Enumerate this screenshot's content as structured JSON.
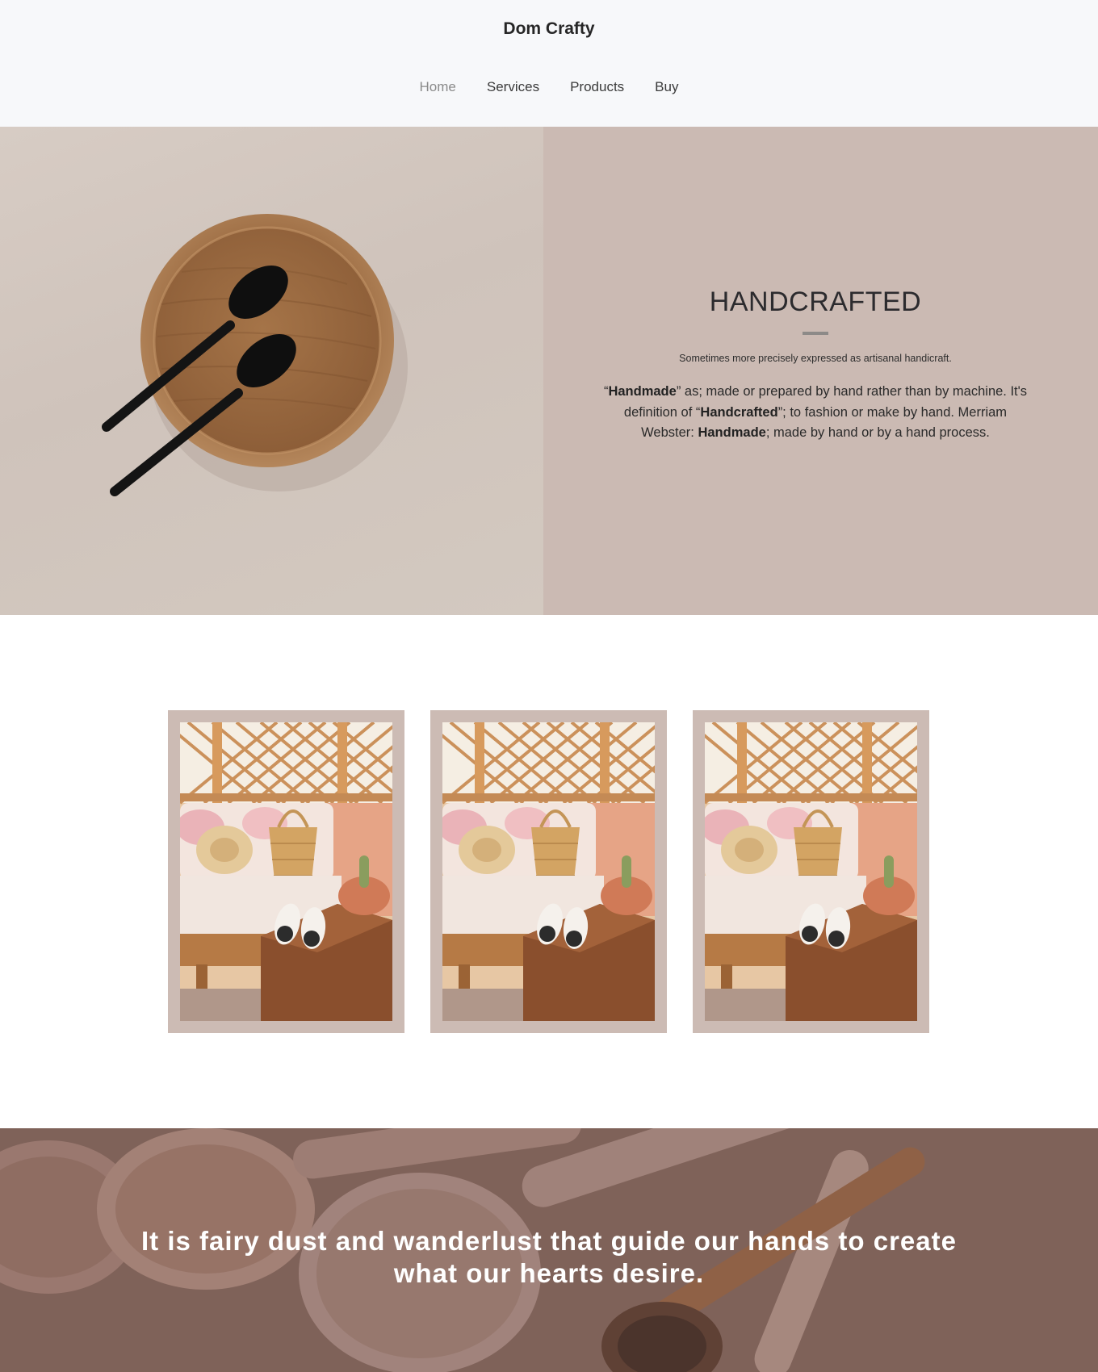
{
  "header": {
    "brand": "Dom Crafty",
    "nav": [
      {
        "label": "Home",
        "active": true
      },
      {
        "label": "Services",
        "active": false
      },
      {
        "label": "Products",
        "active": false
      },
      {
        "label": "Buy",
        "active": false
      }
    ]
  },
  "hero": {
    "title": "HANDCRAFTED",
    "subtitle": "Sometimes more precisely expressed as artisanal handicraft.",
    "body": {
      "p1_open": "“",
      "p1_bold": "Handmade",
      "p1_rest": "” as; made or prepared by hand rather than by machine. It's definition of “",
      "p2_bold": "Handcrafted",
      "p2_rest": "”; to fashion or make by hand. Merriam Webster: ",
      "p3_bold": "Handmade",
      "p3_rest": "; made by hand or by a hand process."
    },
    "image": "wooden-plate-with-black-spoons"
  },
  "gallery": {
    "cards": [
      {
        "image": "patio-bench-with-basket-and-sandals"
      },
      {
        "image": "patio-bench-with-basket-and-sandals"
      },
      {
        "image": "patio-bench-with-basket-and-sandals"
      }
    ]
  },
  "quote": {
    "text": "It is fairy dust and wanderlust that guide our hands to create what our hearts desire.",
    "image": "wooden-spoons-background"
  },
  "colors": {
    "header_bg": "#f7f8fa",
    "hero_bg": "#cbbab3",
    "card_frame": "#ccbbb4",
    "nav_active": "#8a8a8a"
  }
}
